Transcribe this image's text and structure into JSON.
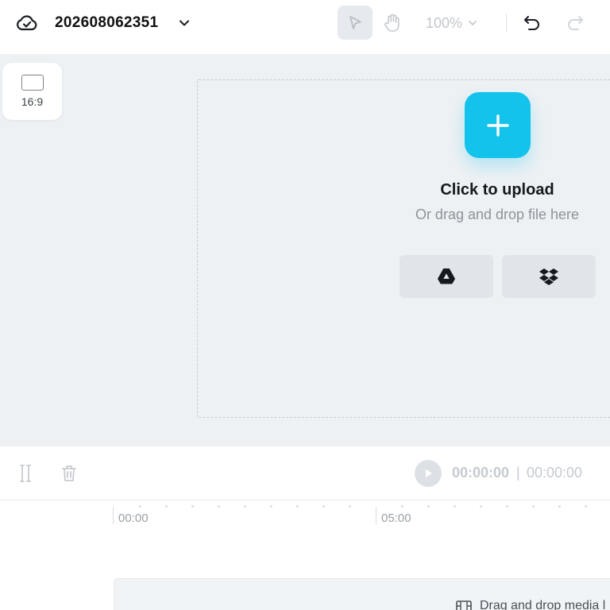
{
  "header": {
    "project_name": "202608062351",
    "zoom_level": "100%"
  },
  "canvas": {
    "aspect_ratio_label": "16:9",
    "upload_title": "Click to upload",
    "upload_subtitle": "Or drag and drop file here"
  },
  "timeline": {
    "current_time": "00:00:00",
    "separator": "|",
    "total_time": "00:00:00",
    "ruler_labels": [
      "00:00",
      "05:00"
    ],
    "track_hint": "Drag and drop media l"
  },
  "colors": {
    "accent": "#14c3ec",
    "canvas_bg": "#eef1f4"
  }
}
